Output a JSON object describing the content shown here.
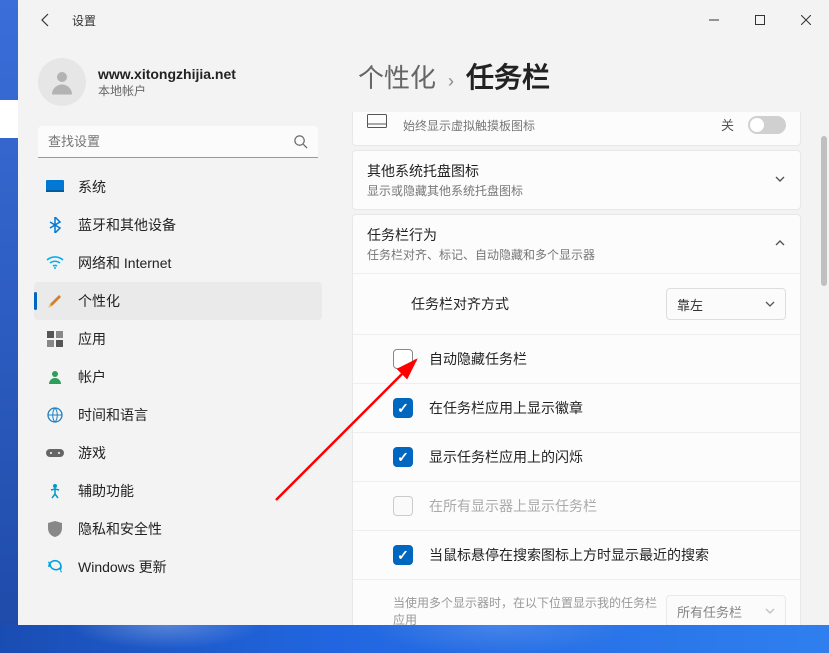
{
  "window": {
    "title": "设置",
    "account": {
      "name": "www.xitongzhijia.net",
      "type": "本地帐户"
    },
    "search_placeholder": "查找设置"
  },
  "sidebar": {
    "items": [
      {
        "label": "系统",
        "icon": "monitor"
      },
      {
        "label": "蓝牙和其他设备",
        "icon": "bluetooth"
      },
      {
        "label": "网络和 Internet",
        "icon": "wifi"
      },
      {
        "label": "个性化",
        "icon": "brush",
        "selected": true
      },
      {
        "label": "应用",
        "icon": "apps"
      },
      {
        "label": "帐户",
        "icon": "person"
      },
      {
        "label": "时间和语言",
        "icon": "globe"
      },
      {
        "label": "游戏",
        "icon": "game"
      },
      {
        "label": "辅助功能",
        "icon": "access"
      },
      {
        "label": "隐私和安全性",
        "icon": "shield"
      },
      {
        "label": "Windows 更新",
        "icon": "update"
      }
    ]
  },
  "breadcrumb": {
    "parent": "个性化",
    "current": "任务栏"
  },
  "panels": {
    "touchpad": {
      "sub": "始终显示虚拟触摸板图标",
      "state_label": "关"
    },
    "tray": {
      "title": "其他系统托盘图标",
      "sub": "显示或隐藏其他系统托盘图标"
    },
    "behavior": {
      "title": "任务栏行为",
      "sub": "任务栏对齐、标记、自动隐藏和多个显示器"
    }
  },
  "settings": {
    "alignment": {
      "label": "任务栏对齐方式",
      "value": "靠左"
    },
    "auto_hide": {
      "label": "自动隐藏任务栏",
      "checked": false
    },
    "badges": {
      "label": "在任务栏应用上显示徽章",
      "checked": true
    },
    "flash": {
      "label": "显示任务栏应用上的闪烁",
      "checked": true
    },
    "all_displays": {
      "label": "在所有显示器上显示任务栏",
      "checked": false,
      "disabled": true
    },
    "search_hover": {
      "label": "当鼠标悬停在搜索图标上方时显示最近的搜索",
      "checked": true
    },
    "multi_display": {
      "label": "当使用多个显示器时，在以下位置显示我的任务栏应用",
      "value": "所有任务栏",
      "disabled": true
    }
  }
}
